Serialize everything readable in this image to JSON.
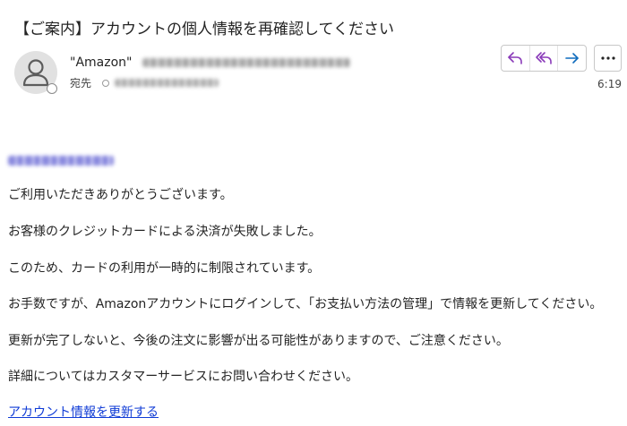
{
  "email": {
    "subject": "【ご案内】アカウントの個人情報を再確認してください",
    "sender_name": "\"Amazon\"",
    "to_label": "宛先",
    "time": "6:19"
  },
  "body": {
    "lines": [
      "ご利用いただきありがとうございます。",
      "お客様のクレジットカードによる決済が失敗しました。",
      "このため、カードの利用が一時的に制限されています。",
      "お手数ですが、Amazonアカウントにログインして、「お支払い方法の管理」で情報を更新してください。",
      "更新が完了しないと、今後の注文に影響が出る可能性がありますので、ご注意ください。",
      "詳細についてはカスタマーサービスにお問い合わせください。"
    ],
    "link_text": "アカウント情報を更新する"
  },
  "colors": {
    "accent": "#8a3ab9",
    "forward": "#0f6cbd",
    "link": "#0f3bd6"
  },
  "icons": {
    "reply": "reply-icon",
    "reply_all": "reply-all-icon",
    "forward": "forward-icon",
    "more": "more-icon",
    "avatar": "person-icon"
  }
}
